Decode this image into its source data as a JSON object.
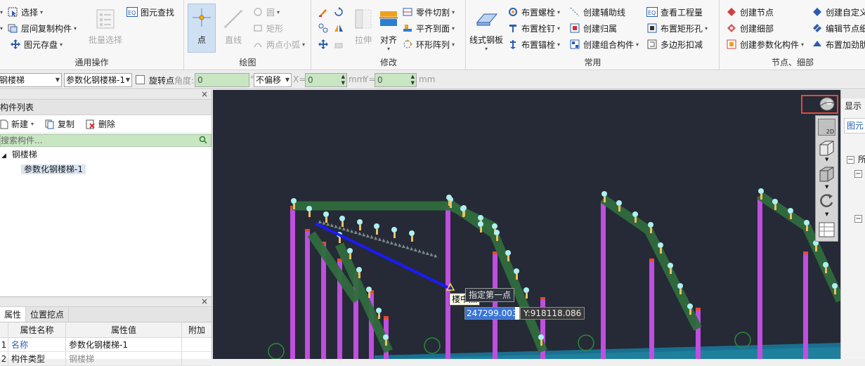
{
  "ribbon": {
    "groups": {
      "common_ops": "通用操作",
      "draw": "绘图",
      "modify": "修改",
      "common": "常用",
      "node_detail": "节点、细部"
    },
    "common_ops": {
      "select": "选择",
      "copy_between_floors": "层间复制构件",
      "save_element": "图元存盘",
      "batch_select": "批量选择",
      "find_element": "图元查找"
    },
    "draw": {
      "point": "点",
      "line": "直线",
      "circle": "圆",
      "rect": "矩形",
      "two_point_arc": "两点小弧"
    },
    "modify": {
      "stretch": "拉伸",
      "align": "对齐",
      "part_cut": "零件切割",
      "flush_face": "平齐到面",
      "ring_array": "环形阵列"
    },
    "common": {
      "line_plate": "线式钢板",
      "place_bolt": "布置螺栓",
      "place_stud": "布置栓钉",
      "place_anchor": "布置锚栓",
      "create_aux_line": "创建辅助线",
      "create_group": "创建归属",
      "create_combo": "创建组合构件",
      "view_quantity": "查看工程量",
      "place_rect_hole": "布置矩形孔",
      "polygon_cut": "多边形扣减"
    },
    "node_detail": {
      "create_node": "创建节点",
      "create_detail": "创建细部",
      "create_param": "创建参数化构件",
      "create_custom": "创建自定义",
      "edit_node": "编辑节点细",
      "place_stiffener": "布置加劲肋"
    }
  },
  "toolbar2": {
    "type_combo": "钢楼梯",
    "instance_combo": "参数化钢楼梯-1",
    "rotate_label": "旋转点",
    "angle_label": "角度:",
    "angle_value": "0",
    "angle_unit": "°",
    "offset_combo": "不偏移",
    "x_label": "X=",
    "x_value": "0",
    "x_unit": "mm",
    "y_label": "Y=",
    "y_value": "0",
    "y_unit": "mm"
  },
  "component_list": {
    "title": "构件列表",
    "new": "新建",
    "copy": "复制",
    "delete": "删除",
    "search_placeholder": "搜索构件...",
    "tree_root": "钢楼梯",
    "tree_child": "参数化钢楼梯-1"
  },
  "properties": {
    "tab_props": "属性",
    "tab_position": "位置挖点",
    "col_name": "属性名称",
    "col_value": "属性值",
    "col_extra": "附加",
    "rows": [
      {
        "idx": "1",
        "name": "名称",
        "value": "参数化钢楼梯-1"
      },
      {
        "idx": "2",
        "name": "构件类型",
        "value": "钢楼梯"
      }
    ]
  },
  "viewport": {
    "snap_label": "楼中点",
    "hint_label": "指定第一点",
    "coord_x": "247299.003",
    "coord_y": "Y:918118.086"
  },
  "viewtools": {
    "view_2d_label": "2D"
  },
  "right_panel": {
    "tab": "显示",
    "subtab": "图元"
  },
  "colors": {
    "viewport_bg": "#252a36",
    "post": "#c04ee0",
    "stringer": "#2f6b3d",
    "preview_line": "#1a1aff",
    "floor": "#1e8fb0",
    "highlight": "#e34a3b"
  }
}
